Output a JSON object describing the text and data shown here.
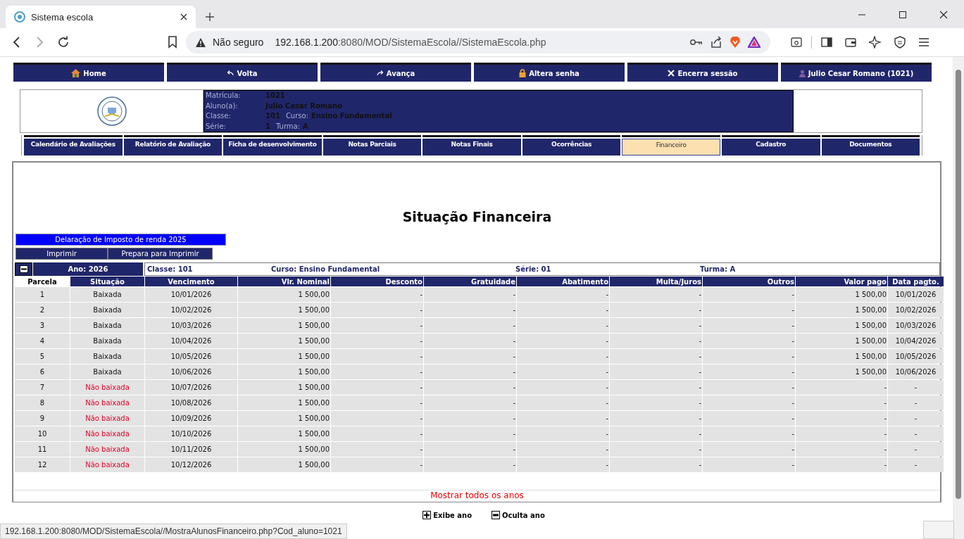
{
  "browser": {
    "tab_title": "Sistema escola",
    "security": "Não seguro",
    "url_host": "192.168.1.200",
    "url_path": ":8080/MOD/SistemaEscola//SistemaEscola.php",
    "status_url": "192.168.1.200:8080/MOD/SistemaEscola//MostraAlunosFinanceiro.php?Cod_aluno=1021"
  },
  "top_nav": [
    {
      "kind": "home",
      "label": "Home"
    },
    {
      "kind": "back",
      "label": "Volta"
    },
    {
      "kind": "forward",
      "label": "Avança"
    },
    {
      "kind": "lock",
      "label": "Altera senha"
    },
    {
      "kind": "close",
      "label": "Encerra sessão"
    },
    {
      "kind": "user",
      "label": "Julio Cesar Romano (1021)"
    }
  ],
  "student": [
    {
      "label": "Matrícula:",
      "value": "1021"
    },
    {
      "label": "Aluno(a):",
      "value": "Julio Cesar Romano"
    },
    {
      "label": "Classe:",
      "value": "101",
      "extra_label": "Curso:",
      "extra_value": "Ensino Fundamental"
    },
    {
      "label": "Série:",
      "value": "1",
      "extra_label": "Turma:",
      "extra_value": "A"
    }
  ],
  "tabs": [
    {
      "label": "Calendário de Avaliações",
      "selected": false
    },
    {
      "label": "Relatório de Avaliação",
      "selected": false
    },
    {
      "label": "Ficha de desenvolvimento",
      "selected": false
    },
    {
      "label": "Notas Parciais",
      "selected": false
    },
    {
      "label": "Notas Finais",
      "selected": false
    },
    {
      "label": "Ocorrências",
      "selected": false
    },
    {
      "label": "Financeiro",
      "selected": true
    },
    {
      "label": "Cadastro",
      "selected": false
    },
    {
      "label": "Documentos",
      "selected": false
    }
  ],
  "title": "Situação Financeira",
  "tax_button": "Delaração de Imposto de renda 2025",
  "print_buttons": [
    "Imprimir",
    "Prepara para Imprimir"
  ],
  "year": {
    "expanded": true,
    "label": "Ano: 2026",
    "classe": "Classe: 101",
    "curso": "Curso: Ensino Fundamental",
    "serie": "Série: 01",
    "turma": "Turma: A"
  },
  "table": {
    "columns": [
      "Parcela",
      "Situação",
      "Vencimento",
      "Vlr. Nominal",
      "Desconto",
      "Gratuidade",
      "Abatimento",
      "Multa/Juros",
      "Outros",
      "Valor pago",
      "Data pagto."
    ],
    "rows": [
      {
        "paid": true,
        "cells": [
          "1",
          "Baixada",
          "10/01/2026",
          "1 500,00",
          "-",
          "-",
          "-",
          "-",
          "-",
          "1 500,00",
          "10/01/2026"
        ]
      },
      {
        "paid": true,
        "cells": [
          "2",
          "Baixada",
          "10/02/2026",
          "1 500,00",
          "-",
          "-",
          "-",
          "-",
          "-",
          "1 500,00",
          "10/02/2026"
        ]
      },
      {
        "paid": true,
        "cells": [
          "3",
          "Baixada",
          "10/03/2026",
          "1 500,00",
          "-",
          "-",
          "-",
          "-",
          "-",
          "1 500,00",
          "10/03/2026"
        ]
      },
      {
        "paid": true,
        "cells": [
          "4",
          "Baixada",
          "10/04/2026",
          "1 500,00",
          "-",
          "-",
          "-",
          "-",
          "-",
          "1 500,00",
          "10/04/2026"
        ]
      },
      {
        "paid": true,
        "cells": [
          "5",
          "Baixada",
          "10/05/2026",
          "1 500,00",
          "-",
          "-",
          "-",
          "-",
          "-",
          "1 500,00",
          "10/05/2026"
        ]
      },
      {
        "paid": true,
        "cells": [
          "6",
          "Baixada",
          "10/06/2026",
          "1 500,00",
          "-",
          "-",
          "-",
          "-",
          "-",
          "1 500,00",
          "10/06/2026"
        ]
      },
      {
        "paid": false,
        "cells": [
          "7",
          "Não baixada",
          "10/07/2026",
          "1 500,00",
          "-",
          "-",
          "-",
          "-",
          "-",
          "-",
          "-"
        ]
      },
      {
        "paid": false,
        "cells": [
          "8",
          "Não baixada",
          "10/08/2026",
          "1 500,00",
          "-",
          "-",
          "-",
          "-",
          "-",
          "-",
          "-"
        ]
      },
      {
        "paid": false,
        "cells": [
          "9",
          "Não baixada",
          "10/09/2026",
          "1 500,00",
          "-",
          "-",
          "-",
          "-",
          "-",
          "-",
          "-"
        ]
      },
      {
        "paid": false,
        "cells": [
          "10",
          "Não baixada",
          "10/10/2026",
          "1 500,00",
          "-",
          "-",
          "-",
          "-",
          "-",
          "-",
          "-"
        ]
      },
      {
        "paid": false,
        "cells": [
          "11",
          "Não baixada",
          "10/11/2026",
          "1 500,00",
          "-",
          "-",
          "-",
          "-",
          "-",
          "-",
          "-"
        ]
      },
      {
        "paid": false,
        "cells": [
          "12",
          "Não baixada",
          "10/12/2026",
          "1 500,00",
          "-",
          "-",
          "-",
          "-",
          "-",
          "-",
          "-"
        ]
      }
    ]
  },
  "show_all_years": "Mostrar todos os anos",
  "legend": [
    {
      "kind": "expand",
      "label": "Exibe ano"
    },
    {
      "kind": "collapse",
      "label": "Oculta ano"
    }
  ]
}
